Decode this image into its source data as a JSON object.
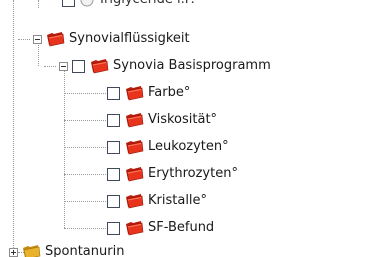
{
  "tree": {
    "top_partial_label": "Triglyceride i.P.",
    "group": {
      "label": "Synovialflüssigkeit",
      "program": {
        "label": "Synovia Basisprogramm",
        "items": [
          {
            "label": "Farbe°"
          },
          {
            "label": "Viskosität°"
          },
          {
            "label": "Leukozyten°"
          },
          {
            "label": "Erythrozyten°"
          },
          {
            "label": "Kristalle°"
          },
          {
            "label": "SF-Befund"
          }
        ]
      }
    },
    "bottom_partial_label": "Spontanurin"
  },
  "colors": {
    "folder_red": "#e8341c",
    "folder_yellow": "#e9b22a",
    "checkbox_border": "#404a59",
    "tree_line": "#9a9a9a"
  },
  "icons": {
    "expanded": "minus-expander-icon",
    "collapsed": "plus-expander-icon",
    "red_folder": "red-folder-icon",
    "yellow_folder": "yellow-folder-icon",
    "checkbox": "checkbox-icon"
  }
}
